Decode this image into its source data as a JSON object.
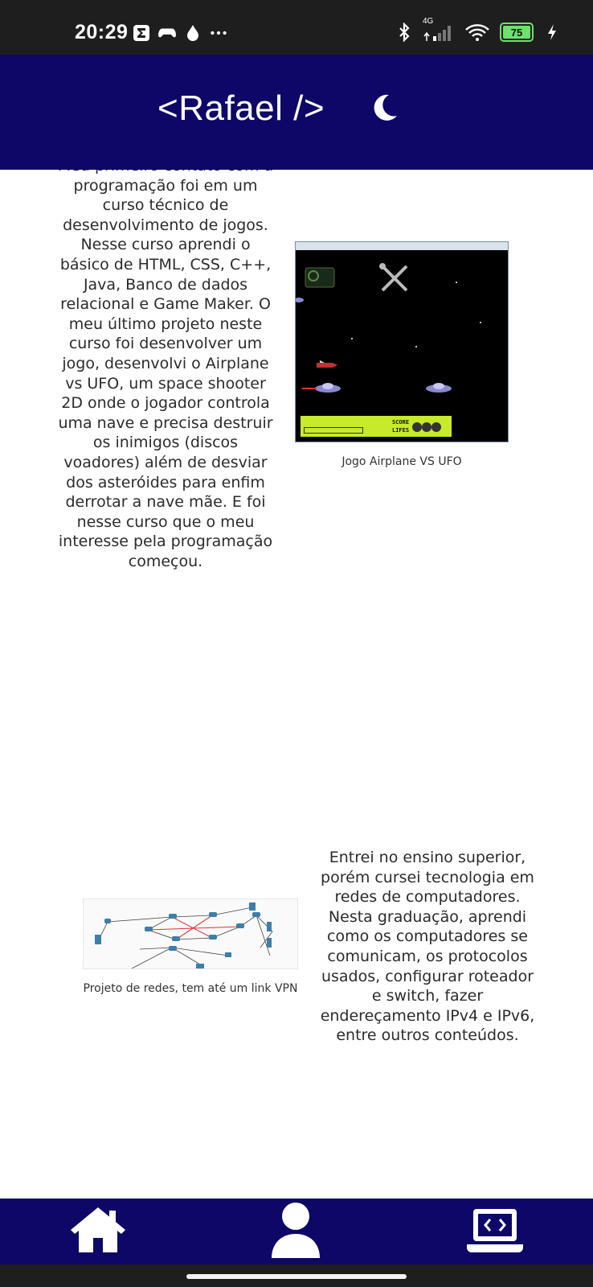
{
  "status_bar": {
    "time": "20:29",
    "left_icons": [
      "sigma-app-icon",
      "gamepad-icon",
      "drop-icon",
      "more-dots-icon"
    ],
    "network_label": "4G",
    "battery_level": "75",
    "right_icons": [
      "bluetooth-icon",
      "signal-icon",
      "wifi-icon",
      "battery-icon",
      "charging-icon"
    ]
  },
  "header": {
    "logo": "<Rafael />",
    "theme_icon": "moon-icon"
  },
  "sections": [
    {
      "text": "Meu primeiro contato com a programação foi em um curso técnico de desenvolvimento de jogos. Nesse curso aprendi o básico de HTML, CSS, C++, Java, Banco de dados relacional e Game Maker. O meu último projeto neste curso foi desenvolver um jogo, desenvolvi o Airplane vs UFO, um space shooter 2D onde o jogador controla uma nave e precisa destruir os inimigos (discos voadores) além de desviar dos asteróides para enfim derrotar a nave mãe. E foi nesse curso que o meu interesse pela programação começou.",
      "image_caption": "Jogo Airplane VS UFO",
      "screenshot_hud": {
        "score_label": "SCORE",
        "lifes_label": "LIFES"
      }
    },
    {
      "text": "Entrei no ensino superior, porém cursei tecnologia em redes de computadores. Nesta graduação, aprendi como os computadores se comunicam, os protocolos usados, configurar roteador e switch, fazer endereçamento IPv4 e IPv6, entre outros conteúdos.",
      "image_caption": "Projeto de redes, tem até um link VPN"
    }
  ],
  "bottom_nav": {
    "items": [
      {
        "icon": "home-icon"
      },
      {
        "icon": "user-icon"
      },
      {
        "icon": "laptop-code-icon"
      }
    ]
  },
  "colors": {
    "header_bg": "#0e0767",
    "status_bg": "#1e1e1e",
    "battery_green": "#6ee06e"
  }
}
